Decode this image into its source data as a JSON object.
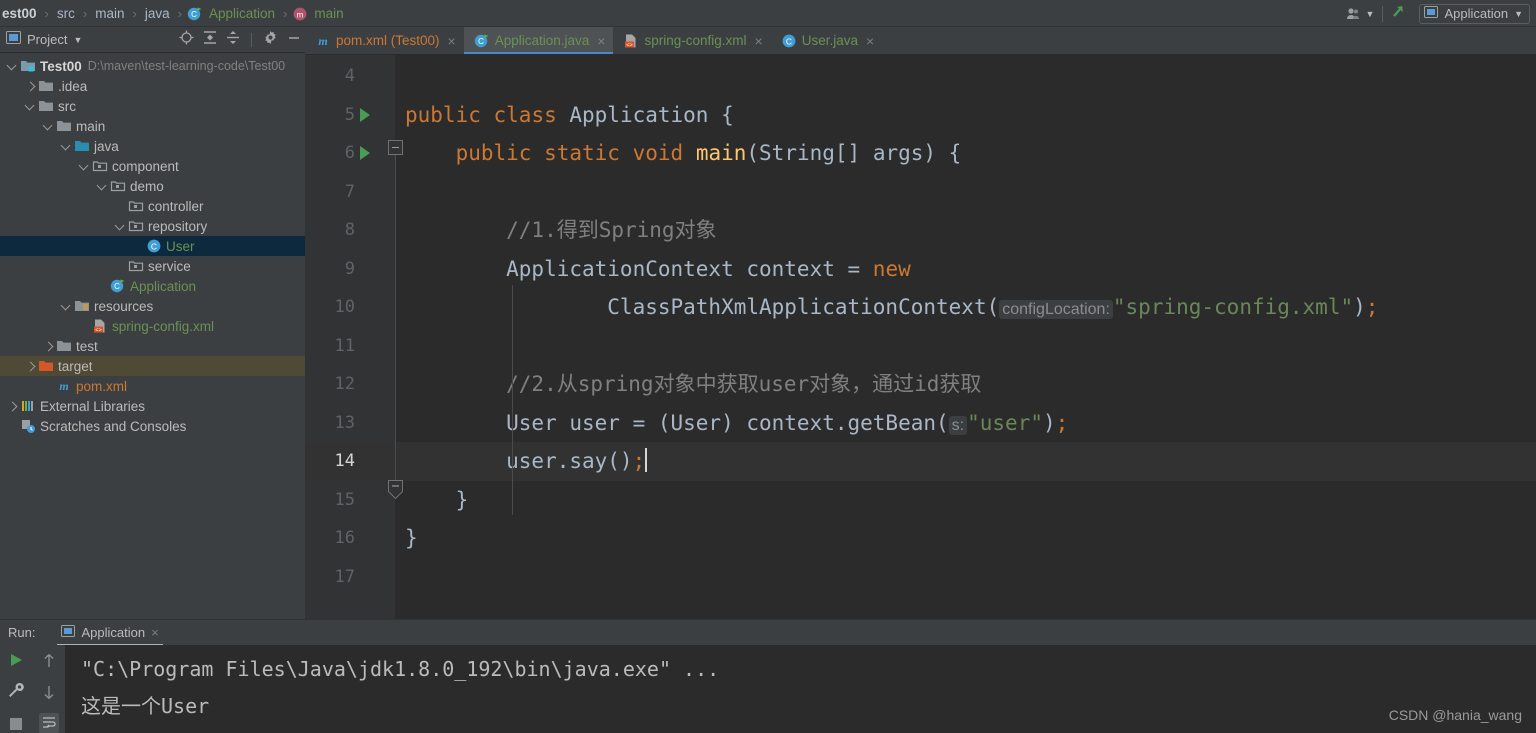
{
  "breadcrumb": {
    "items": [
      {
        "label": "est00",
        "icon": "",
        "style": "bold"
      },
      {
        "label": "src",
        "icon": "",
        "style": "plain"
      },
      {
        "label": "main",
        "icon": "",
        "style": "plain"
      },
      {
        "label": "java",
        "icon": "",
        "style": "plain"
      },
      {
        "label": "Application",
        "icon": "class-run-icon",
        "style": "green"
      },
      {
        "label": "main",
        "icon": "method-icon",
        "style": "green"
      }
    ]
  },
  "topbar": {
    "user_icon": "user-accounts-icon",
    "vcs_icon": "vcs-update-arrow-icon",
    "run_config": {
      "label": "Application",
      "icon": "run-configuration-icon",
      "chevron": "chevron-down-icon"
    }
  },
  "project_panel": {
    "title": "Project",
    "chevron": "chevron-down-icon",
    "tools": [
      {
        "name": "locate-icon",
        "glyph": "locate"
      },
      {
        "name": "expand-all-icon",
        "glyph": "expand"
      },
      {
        "name": "collapse-all-icon",
        "glyph": "collapse"
      },
      {
        "name": "settings-gear-icon",
        "glyph": "gear"
      },
      {
        "name": "hide-panel-icon",
        "glyph": "minus"
      }
    ],
    "tree": [
      {
        "label": "Test00",
        "path": "D:\\maven\\test-learning-code\\Test00",
        "indent": 0,
        "arrow": "down",
        "icon": "module-folder-icon",
        "style": "bold",
        "state": "normal"
      },
      {
        "label": ".idea",
        "path": "",
        "indent": 1,
        "arrow": "right",
        "icon": "folder-icon",
        "style": "plain",
        "state": "normal"
      },
      {
        "label": "src",
        "path": "",
        "indent": 1,
        "arrow": "down",
        "icon": "folder-icon",
        "style": "plain",
        "state": "normal"
      },
      {
        "label": "main",
        "path": "",
        "indent": 2,
        "arrow": "down",
        "icon": "folder-icon",
        "style": "plain",
        "state": "normal"
      },
      {
        "label": "java",
        "path": "",
        "indent": 3,
        "arrow": "down",
        "icon": "source-folder-icon",
        "style": "plain",
        "state": "normal"
      },
      {
        "label": "component",
        "path": "",
        "indent": 4,
        "arrow": "down",
        "icon": "package-icon",
        "style": "plain",
        "state": "normal"
      },
      {
        "label": "demo",
        "path": "",
        "indent": 5,
        "arrow": "down",
        "icon": "package-icon",
        "style": "plain",
        "state": "normal"
      },
      {
        "label": "controller",
        "path": "",
        "indent": 6,
        "arrow": "none",
        "icon": "package-icon",
        "style": "plain",
        "state": "normal"
      },
      {
        "label": "repository",
        "path": "",
        "indent": 6,
        "arrow": "down",
        "icon": "package-icon",
        "style": "plain",
        "state": "normal"
      },
      {
        "label": "User",
        "path": "",
        "indent": 7,
        "arrow": "none",
        "icon": "java-class-icon",
        "style": "green",
        "state": "selected"
      },
      {
        "label": "service",
        "path": "",
        "indent": 6,
        "arrow": "none",
        "icon": "package-icon",
        "style": "plain",
        "state": "normal"
      },
      {
        "label": "Application",
        "path": "",
        "indent": 5,
        "arrow": "none",
        "icon": "class-run-icon",
        "style": "green",
        "state": "normal"
      },
      {
        "label": "resources",
        "path": "",
        "indent": 3,
        "arrow": "down",
        "icon": "resource-folder-icon",
        "style": "plain",
        "state": "normal"
      },
      {
        "label": "spring-config.xml",
        "path": "",
        "indent": 4,
        "arrow": "none",
        "icon": "spring-xml-icon",
        "style": "green",
        "state": "normal"
      },
      {
        "label": "test",
        "path": "",
        "indent": 2,
        "arrow": "right",
        "icon": "folder-icon",
        "style": "plain",
        "state": "normal"
      },
      {
        "label": "target",
        "path": "",
        "indent": 1,
        "arrow": "right",
        "icon": "excluded-folder-icon",
        "style": "plain",
        "state": "highlighted"
      },
      {
        "label": "pom.xml",
        "path": "",
        "indent": 2,
        "arrow": "none",
        "icon": "maven-pom-icon",
        "style": "orange",
        "state": "normal"
      },
      {
        "label": "External Libraries",
        "path": "",
        "indent": 0,
        "arrow": "right",
        "icon": "libraries-icon",
        "style": "plain",
        "state": "normal"
      },
      {
        "label": "Scratches and Consoles",
        "path": "",
        "indent": 0,
        "arrow": "none",
        "icon": "scratches-icon",
        "style": "plain",
        "state": "normal"
      }
    ]
  },
  "editor": {
    "tabs": [
      {
        "label": "pom.xml (Test00)",
        "icon": "maven-pom-icon",
        "color": "orange",
        "active": false,
        "close": "×"
      },
      {
        "label": "Application.java",
        "icon": "class-run-icon",
        "color": "green",
        "active": true,
        "close": "×"
      },
      {
        "label": "spring-config.xml",
        "icon": "spring-xml-icon",
        "color": "green",
        "active": false,
        "close": "×"
      },
      {
        "label": "User.java",
        "icon": "java-class-icon",
        "color": "green",
        "active": false,
        "close": "×"
      }
    ],
    "lines": [
      {
        "num": "4",
        "runmark": false,
        "current": false,
        "text": ""
      },
      {
        "num": "5",
        "runmark": true,
        "current": false,
        "text": "public class Application {"
      },
      {
        "num": "6",
        "runmark": true,
        "current": false,
        "text": "    public static void main(String[] args) {"
      },
      {
        "num": "7",
        "runmark": false,
        "current": false,
        "text": ""
      },
      {
        "num": "8",
        "runmark": false,
        "current": false,
        "text": "        //1.得到Spring对象"
      },
      {
        "num": "9",
        "runmark": false,
        "current": false,
        "text": "        ApplicationContext context = new"
      },
      {
        "num": "10",
        "runmark": false,
        "current": false,
        "text": "                ClassPathXmlApplicationContext( configLocation: \"spring-config.xml\");"
      },
      {
        "num": "11",
        "runmark": false,
        "current": false,
        "text": ""
      },
      {
        "num": "12",
        "runmark": false,
        "current": false,
        "text": "        //2.从 spring对象中获取user对象，通过id获取"
      },
      {
        "num": "13",
        "runmark": false,
        "current": false,
        "text": "        User user = (User) context.getBean( s: \"user\");"
      },
      {
        "num": "14",
        "runmark": false,
        "current": true,
        "text": "        user.say();"
      },
      {
        "num": "15",
        "runmark": false,
        "current": false,
        "text": "    }"
      },
      {
        "num": "16",
        "runmark": false,
        "current": false,
        "text": "}"
      },
      {
        "num": "17",
        "runmark": false,
        "current": false,
        "text": ""
      }
    ],
    "code_tokens": {
      "l5": [
        {
          "t": "public ",
          "c": "kw"
        },
        {
          "t": "class ",
          "c": "kw"
        },
        {
          "t": "Application",
          "c": "cls"
        },
        {
          "t": " {",
          "c": "pl"
        }
      ],
      "l6": [
        {
          "t": "    public ",
          "c": "kw"
        },
        {
          "t": "static ",
          "c": "kw"
        },
        {
          "t": "void ",
          "c": "kw"
        },
        {
          "t": "main",
          "c": "mth"
        },
        {
          "t": "(String[] args) {",
          "c": "pl"
        }
      ],
      "l8": [
        {
          "t": "        //1.得到Spring对象",
          "c": "cmt"
        }
      ],
      "l9": [
        {
          "t": "        ApplicationContext context = ",
          "c": "pl"
        },
        {
          "t": "new",
          "c": "kw"
        }
      ],
      "l10": [
        {
          "t": "                ClassPathXmlApplicationContext",
          "c": "pl"
        },
        {
          "t": "(",
          "c": "pl"
        },
        {
          "t": "configLocation:",
          "c": "hint"
        },
        {
          "t": "\"spring-config.xml\"",
          "c": "str"
        },
        {
          "t": ")",
          "c": "pl"
        },
        {
          "t": ";",
          "c": "semi"
        }
      ],
      "l12": [
        {
          "t": "        //2.从spring对象中获取user对象，通过id获取",
          "c": "cmt"
        }
      ],
      "l13": [
        {
          "t": "        User user = (User) context.getBean",
          "c": "pl"
        },
        {
          "t": "(",
          "c": "pl"
        },
        {
          "t": "s:",
          "c": "hint"
        },
        {
          "t": "\"user\"",
          "c": "str"
        },
        {
          "t": ")",
          "c": "pl"
        },
        {
          "t": ";",
          "c": "semi"
        }
      ],
      "l14": [
        {
          "t": "        user.say()",
          "c": "pl"
        },
        {
          "t": ";",
          "c": "semi"
        }
      ],
      "l15": [
        {
          "t": "    }",
          "c": "pl"
        }
      ],
      "l16": [
        {
          "t": "}",
          "c": "pl"
        }
      ]
    }
  },
  "run_panel": {
    "label": "Run:",
    "tab_label": "Application",
    "tab_icon": "run-configuration-icon",
    "tab_close": "×",
    "tools_left": [
      {
        "name": "rerun-play-icon"
      },
      {
        "name": "wrench-settings-icon"
      },
      {
        "name": "stop-icon"
      }
    ],
    "tools_right": [
      {
        "name": "up-arrow-icon"
      },
      {
        "name": "down-arrow-icon"
      },
      {
        "name": "soft-wrap-icon"
      }
    ],
    "console_lines": [
      {
        "text": "\"C:\\Program Files\\Java\\jdk1.8.0_192\\bin\\java.exe\" ...",
        "highlighted": true
      },
      {
        "text": "这是一个User",
        "highlighted": false
      }
    ]
  },
  "watermark": "CSDN @hania_wang",
  "colors": {
    "bg_panel": "#3c3f41",
    "bg_editor": "#2b2b2b",
    "gutter": "#313335",
    "accent_blue": "#4a88c7",
    "selection": "#0d293e",
    "highlight_olive": "#4e4a36",
    "keyword": "#cc7832",
    "string": "#6a8759",
    "method": "#ffc66d",
    "text": "#a9b7c6",
    "comment": "#808080",
    "green_run": "#499c54"
  }
}
